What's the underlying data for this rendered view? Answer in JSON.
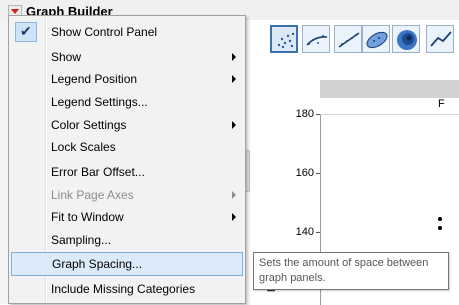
{
  "window": {
    "title": "Graph Builder"
  },
  "menu": {
    "items": [
      {
        "label": "Show Control Panel",
        "checked": true,
        "submenu": false,
        "disabled": false
      },
      {
        "label": "Show",
        "checked": false,
        "submenu": true,
        "disabled": false
      },
      {
        "label": "Legend Position",
        "checked": false,
        "submenu": true,
        "disabled": false
      },
      {
        "label": "Legend Settings...",
        "checked": false,
        "submenu": false,
        "disabled": false
      },
      {
        "label": "Color Settings",
        "checked": false,
        "submenu": true,
        "disabled": false
      },
      {
        "label": "Lock Scales",
        "checked": false,
        "submenu": false,
        "disabled": false
      },
      {
        "label": "Error Bar Offset...",
        "checked": false,
        "submenu": false,
        "disabled": false
      },
      {
        "label": "Link Page Axes",
        "checked": false,
        "submenu": true,
        "disabled": true
      },
      {
        "label": "Fit to Window",
        "checked": false,
        "submenu": true,
        "disabled": false
      },
      {
        "label": "Sampling...",
        "checked": false,
        "submenu": false,
        "disabled": false
      },
      {
        "label": "Graph Spacing...",
        "checked": false,
        "submenu": false,
        "disabled": false,
        "highlighted": true
      },
      {
        "label": "Include Missing Categories",
        "checked": false,
        "submenu": false,
        "disabled": false
      }
    ],
    "check_glyph": "✔"
  },
  "tooltip": {
    "text": "Sets the amount of space between graph panels."
  },
  "graph": {
    "header_label": "F",
    "y_ticks": [
      "180",
      "160",
      "140"
    ],
    "y_axis_title_fragment": "ht"
  },
  "toolbar": {
    "icons": [
      "points-icon",
      "smoother-icon",
      "line-of-fit-icon",
      "ellipse-icon",
      "contour-icon",
      "line-icon"
    ]
  },
  "colors": {
    "menu_highlight": "#dcebfa",
    "title_arrow": "#cc1f1f",
    "toolbar_selected": "#3a6fb0"
  }
}
